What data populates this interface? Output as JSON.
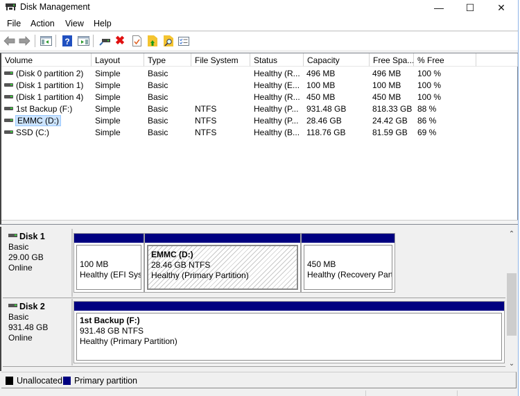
{
  "window": {
    "title": "Disk Management",
    "controls": {
      "minimize": "—",
      "maximize": "☐",
      "close": "✕"
    }
  },
  "menu": [
    "File",
    "Action",
    "View",
    "Help"
  ],
  "toolbar": {
    "buttons": [
      {
        "name": "back-button",
        "icon": "back-arrow-icon"
      },
      {
        "name": "forward-button",
        "icon": "forward-arrow-icon"
      },
      {
        "name": "show-hide-console-tree-button",
        "icon": "console-tree-icon"
      },
      {
        "name": "help-button",
        "icon": "help-icon",
        "glyph": "?"
      },
      {
        "name": "show-hide-action-pane-button",
        "icon": "action-pane-icon"
      },
      {
        "name": "connect-virtual-disk-button",
        "icon": "connect-icon"
      },
      {
        "name": "delete-button",
        "icon": "delete-icon",
        "glyph": "✖"
      },
      {
        "name": "properties-button",
        "icon": "properties-icon"
      },
      {
        "name": "up-level-button",
        "icon": "folder-up-icon"
      },
      {
        "name": "search-button",
        "icon": "folder-search-icon"
      },
      {
        "name": "list-view-button",
        "icon": "checklist-icon"
      }
    ]
  },
  "volume_list": {
    "columns": [
      "Volume",
      "Layout",
      "Type",
      "File System",
      "Status",
      "Capacity",
      "Free Spa...",
      "% Free"
    ],
    "rows": [
      {
        "volume": "(Disk 0 partition 2)",
        "layout": "Simple",
        "type": "Basic",
        "fs": "",
        "status": "Healthy (R...",
        "capacity": "496 MB",
        "free": "496 MB",
        "pct": "100 %"
      },
      {
        "volume": "(Disk 1 partition 1)",
        "layout": "Simple",
        "type": "Basic",
        "fs": "",
        "status": "Healthy (E...",
        "capacity": "100 MB",
        "free": "100 MB",
        "pct": "100 %"
      },
      {
        "volume": "(Disk 1 partition 4)",
        "layout": "Simple",
        "type": "Basic",
        "fs": "",
        "status": "Healthy (R...",
        "capacity": "450 MB",
        "free": "450 MB",
        "pct": "100 %"
      },
      {
        "volume": "1st Backup (F:)",
        "layout": "Simple",
        "type": "Basic",
        "fs": "NTFS",
        "status": "Healthy (P...",
        "capacity": "931.48 GB",
        "free": "818.33 GB",
        "pct": "88 %"
      },
      {
        "volume": "EMMC (D:)",
        "layout": "Simple",
        "type": "Basic",
        "fs": "NTFS",
        "status": "Healthy (P...",
        "capacity": "28.46 GB",
        "free": "24.42 GB",
        "pct": "86 %",
        "selected": true
      },
      {
        "volume": "SSD (C:)",
        "layout": "Simple",
        "type": "Basic",
        "fs": "NTFS",
        "status": "Healthy (B...",
        "capacity": "118.76 GB",
        "free": "81.59 GB",
        "pct": "69 %"
      }
    ]
  },
  "disks": [
    {
      "name": "Disk 1",
      "type": "Basic",
      "size": "29.00 GB",
      "state": "Online",
      "partitions": [
        {
          "name": "",
          "size": "100 MB",
          "status": "Healthy (EFI Syst"
        },
        {
          "name": "EMMC  (D:)",
          "size": "28.46 GB NTFS",
          "status": "Healthy (Primary Partition)",
          "selected": true
        },
        {
          "name": "",
          "size": "450 MB",
          "status": "Healthy (Recovery Part"
        }
      ]
    },
    {
      "name": "Disk 2",
      "type": "Basic",
      "size": "931.48 GB",
      "state": "Online",
      "partitions": [
        {
          "name": "1st Backup  (F:)",
          "size": "931.48 GB NTFS",
          "status": "Healthy (Primary Partition)"
        }
      ]
    }
  ],
  "legend": [
    {
      "label": "Unallocated",
      "color": "#000000"
    },
    {
      "label": "Primary partition",
      "color": "#000080"
    }
  ],
  "colors": {
    "primary_partition": "#000080",
    "selection": "#cce4ff"
  }
}
